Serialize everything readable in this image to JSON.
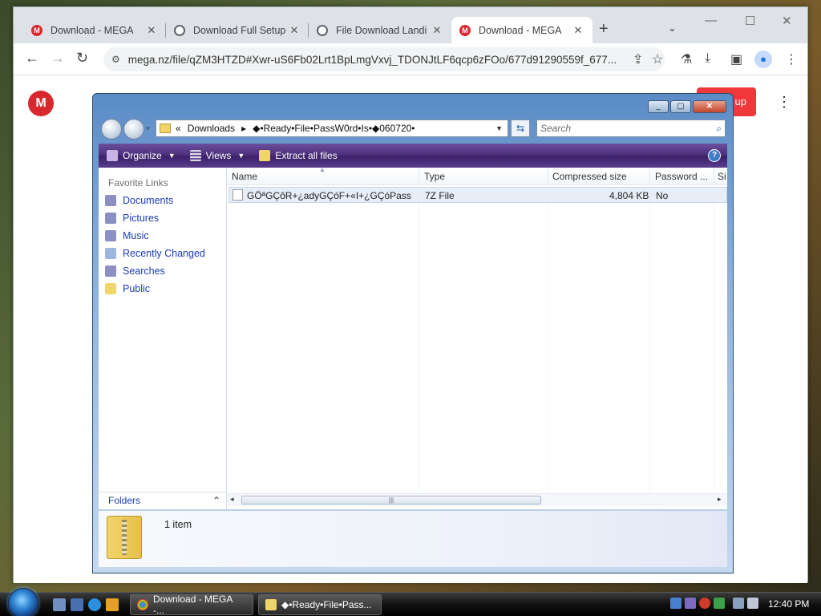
{
  "browser": {
    "tabs": [
      {
        "title": "Download - MEGA",
        "favicon": "mega-icon",
        "active": false
      },
      {
        "title": "Download Full Setup",
        "favicon": "globe-icon",
        "active": false
      },
      {
        "title": "File Download Landi",
        "favicon": "globe-icon",
        "active": false
      },
      {
        "title": "Download - MEGA",
        "favicon": "mega-icon",
        "active": true
      }
    ],
    "url": "mega.nz/file/qZM3HTZD#Xwr-uS6Fb02Lrt1BpLmgVxvj_TDONJtLF6qcp6zFOo/677d91290559f_677...",
    "window_controls": {
      "minimize": "—",
      "maximize": "☐",
      "close": "✕"
    }
  },
  "page": {
    "logo": "M",
    "setup_button": "up",
    "menu_glyph": "⋮"
  },
  "explorer": {
    "breadcrumb": [
      "«",
      "Downloads",
      "▸",
      "◆•Ready•File•PassW0rd•Is•◆060720•"
    ],
    "search_placeholder": "Search",
    "commands": {
      "organize": "Organize",
      "views": "Views",
      "extract": "Extract all files"
    },
    "favorite_links_title": "Favorite Links",
    "favorite_links": [
      "Documents",
      "Pictures",
      "Music",
      "Recently Changed",
      "Searches",
      "Public"
    ],
    "folders_label": "Folders",
    "columns": [
      "Name",
      "Type",
      "Compressed size",
      "Password ...",
      "Si"
    ],
    "files": [
      {
        "name": "GÖªGÇôR+¿adyGÇóF+«I+¿GÇóPassW",
        "type": "7Z File",
        "size": "4,804 KB",
        "password": "No"
      }
    ],
    "status": "1 item"
  },
  "taskbar": {
    "buttons": [
      "Download - MEGA -...",
      "◆•Ready•File•Pass..."
    ],
    "clock": "12:40 PM"
  }
}
